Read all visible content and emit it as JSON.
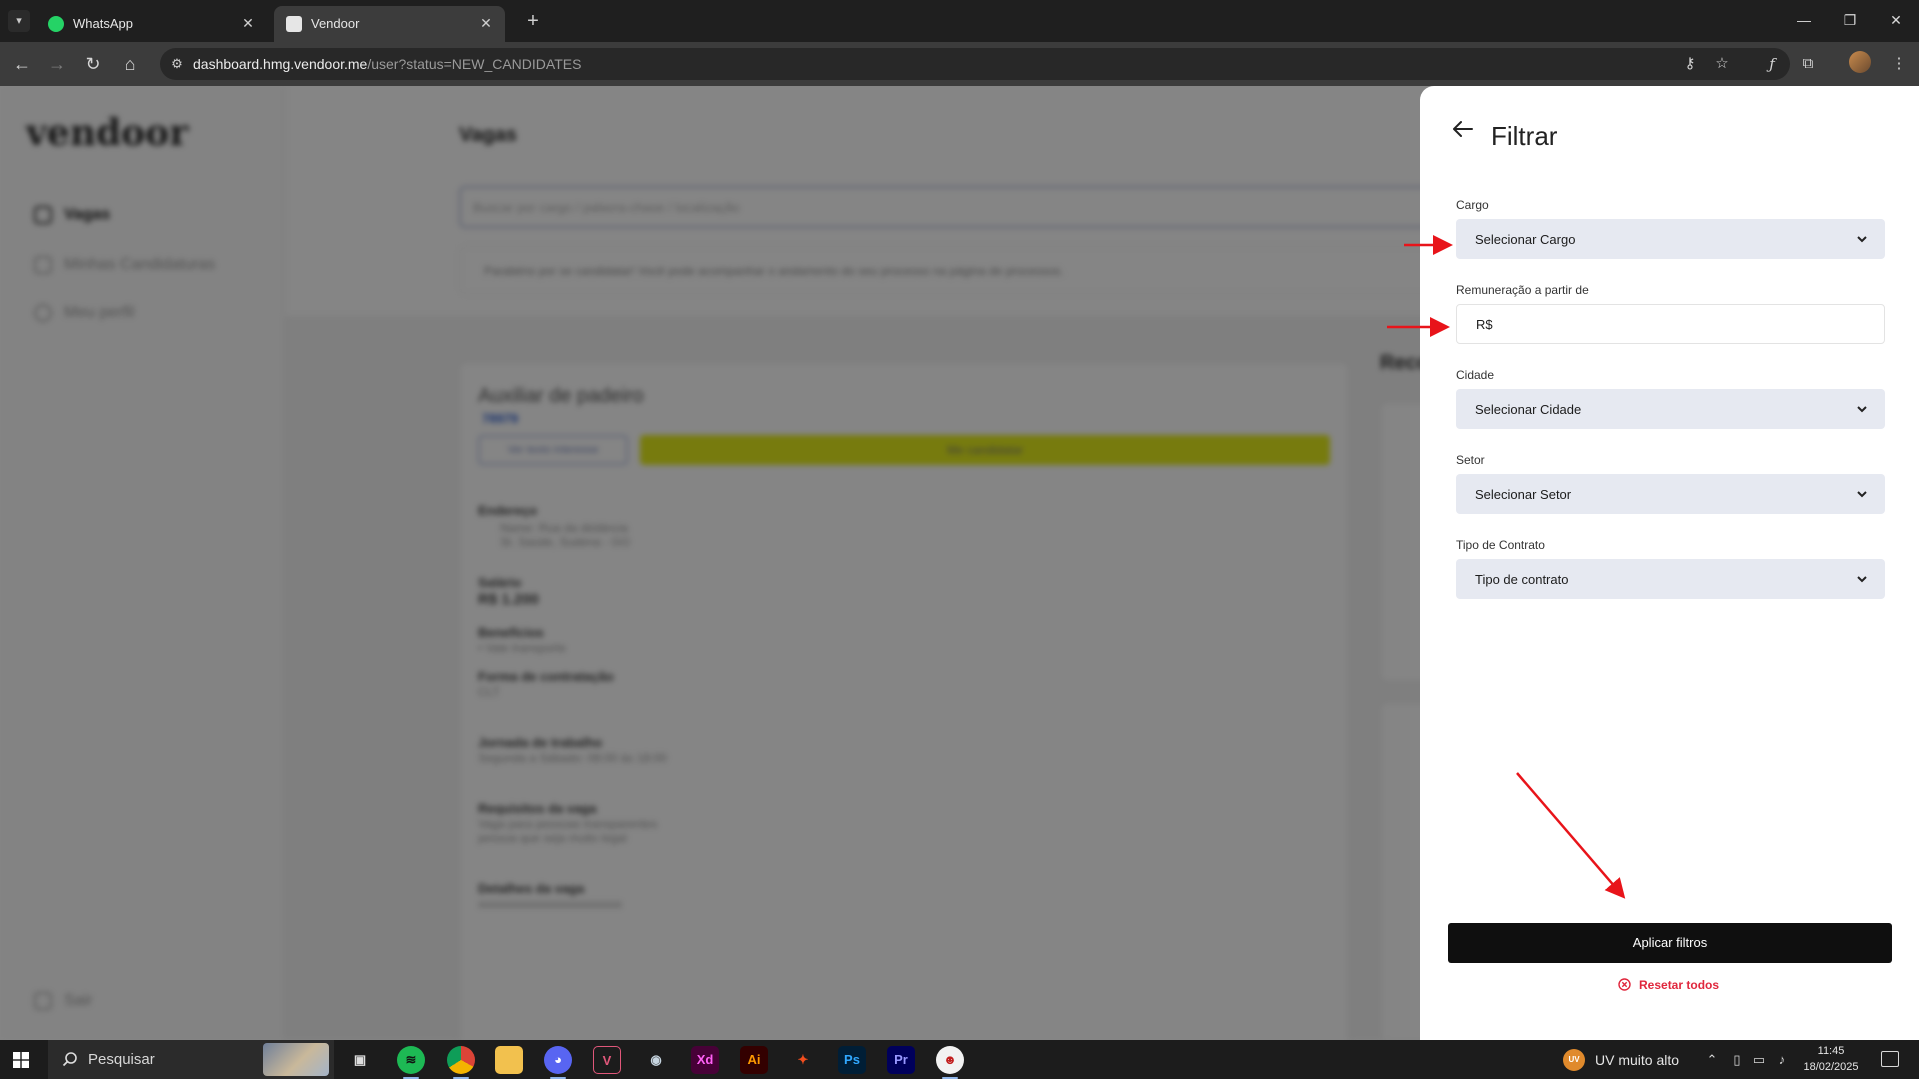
{
  "browser": {
    "tabs": [
      {
        "title": "WhatsApp",
        "active": false,
        "favicon_color": "#25d366"
      },
      {
        "title": "Vendoor",
        "active": true,
        "favicon_color": "#e6e6e6"
      }
    ],
    "url_host": "dashboard.hmg.vendoor.me",
    "url_path": "/user?status=NEW_CANDIDATES"
  },
  "app": {
    "logo": "vendoor",
    "nav": [
      {
        "label": "Vagas",
        "active": true
      },
      {
        "label": "Minhas Candidaturas",
        "active": false
      },
      {
        "label": "Meu perfil",
        "active": false
      }
    ],
    "logout": "Sair",
    "page_title": "Vagas",
    "search_placeholder": "Buscar por cargo / palavra-chave / localização",
    "notice": "Parabéns por se candidatar! Você pode acompanhar o andamento do seu processo na página de processos.",
    "job": {
      "title": "Auxiliar de padeiro",
      "id": "78979",
      "outline_button": "Ver texto interesse",
      "apply_button": "Me candidatar",
      "address_label": "Endereço",
      "address_line1": "Name: Rua da distância",
      "address_line2": "St. Saúde, Sudena - GO",
      "salary_label": "Salário",
      "salary_value": "R$ 1.200",
      "benefits_label": "Benefícios",
      "benefits_value": "• Vale transporte",
      "contract_label": "Forma de contratação",
      "contract_value": "CLT",
      "schedule_label": "Jornada de trabalho",
      "schedule_value": "Segunda a Sábado: 08:00 às 18:00",
      "requirements_label": "Requisitos da vaga",
      "requirements_line1": "Vaga para pessoas transparentes",
      "requirements_line2": "pessoa que seja muito legal",
      "details_label": "Detalhes da vaga",
      "details_value": "xxxxxxxxxxxxxxxxxxxxxxxx"
    },
    "recommended_header": "Reco"
  },
  "filter": {
    "title": "Filtrar",
    "fields": [
      {
        "label": "Cargo",
        "type": "select",
        "value": "Selecionar Cargo"
      },
      {
        "label": "Remuneração a partir de",
        "type": "input",
        "value": "R$"
      },
      {
        "label": "Cidade",
        "type": "select",
        "value": "Selecionar Cidade"
      },
      {
        "label": "Setor",
        "type": "select",
        "value": "Selecionar Setor"
      },
      {
        "label": "Tipo de Contrato",
        "type": "select",
        "value": "Tipo de contrato"
      }
    ],
    "apply_label": "Aplicar filtros",
    "reset_label": "Resetar todos"
  },
  "taskbar": {
    "search_label": "Pesquisar",
    "apps": [
      "task-view",
      "spotify",
      "chrome",
      "file-explorer",
      "discord",
      "vectary",
      "steam",
      "adobe-xd",
      "illustrator",
      "figma",
      "photoshop",
      "premiere",
      "app-mask"
    ],
    "weather_badge": "UV",
    "weather_text": "UV muito alto",
    "time": "11:45",
    "date": "18/02/2025"
  },
  "colors": {
    "annotation_arrows": "#e8141a",
    "apply_button": "#0f0f0f",
    "reset": "#e0273d",
    "select_bg": "#e6e9f1"
  }
}
